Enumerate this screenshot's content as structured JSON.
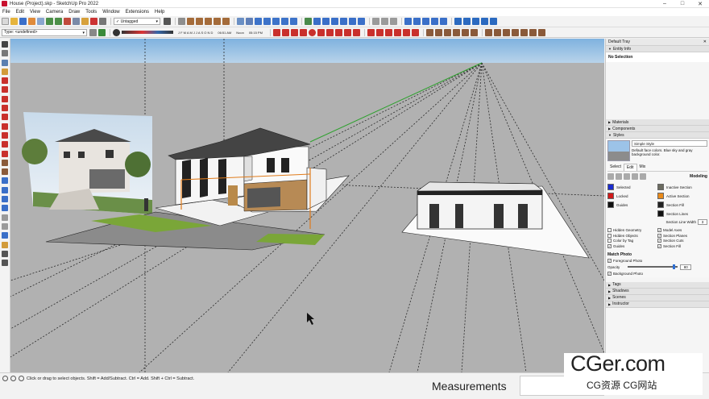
{
  "window": {
    "title": "House (Project).skp - SketchUp Pro 2022",
    "minimize": "–",
    "maximize": "□",
    "close": "✕"
  },
  "menu": [
    "File",
    "Edit",
    "View",
    "Camera",
    "Draw",
    "Tools",
    "Window",
    "Extensions",
    "Help"
  ],
  "toolbar": {
    "tag_select": "✓ Untagged",
    "type_select": "Type: <undefined>",
    "months": "J F M A M J J A S O N D",
    "time_start": "06:51 AM",
    "noon": "Noon",
    "time_end": "05:15 PM"
  },
  "tray": {
    "title": "Default Tray",
    "close": "✕",
    "entity_info": {
      "title": "Entity Info",
      "selection": "No Selection"
    },
    "materials": "Materials",
    "components": "Components",
    "styles": {
      "title": "Styles",
      "name": "Simple Style",
      "description": "Default face colors. Blue sky and gray background color.",
      "tabs": [
        "Select",
        "Edit",
        "Mix"
      ],
      "mode": "Modeling",
      "colors_left": [
        {
          "label": "Selected",
          "color": "#1a2ccf"
        },
        {
          "label": "Locked",
          "color": "#d11a1a"
        },
        {
          "label": "Guides",
          "color": "#111111"
        }
      ],
      "colors_right": [
        {
          "label": "Inactive Section",
          "color": "#6b6b5f"
        },
        {
          "label": "Active Section",
          "color": "#e98a1a"
        },
        {
          "label": "Section Fill",
          "color": "#222222"
        },
        {
          "label": "Section Lines",
          "color": "#111111"
        }
      ],
      "section_line_width_label": "Section Line Width",
      "section_line_width": "3",
      "checkboxes_left": [
        {
          "label": "Hidden Geometry",
          "checked": false
        },
        {
          "label": "Hidden Objects",
          "checked": false
        },
        {
          "label": "Color by Tag",
          "checked": false
        },
        {
          "label": "Guides",
          "checked": true
        }
      ],
      "checkboxes_right": [
        {
          "label": "Model Axes",
          "checked": true
        },
        {
          "label": "Section Planes",
          "checked": true
        },
        {
          "label": "Section Cuts",
          "checked": true
        },
        {
          "label": "Section Fill",
          "checked": true
        }
      ],
      "match_photo": {
        "title": "Match Photo",
        "foreground": "Foreground Photo",
        "opacity_label": "Opacity",
        "opacity": "80",
        "background": "Background Photo"
      }
    },
    "tags": "Tags",
    "shadows": "Shadows",
    "scenes": "Scenes",
    "instructor": "Instructor"
  },
  "status": {
    "text": "Click or drag to select objects. Shift = Add/Subtract. Ctrl = Add. Shift + Ctrl = Subtract.",
    "measurements_label": "Measurements",
    "watermark_main": "CGer.com",
    "watermark_sub": "CG资源 CG网站"
  }
}
